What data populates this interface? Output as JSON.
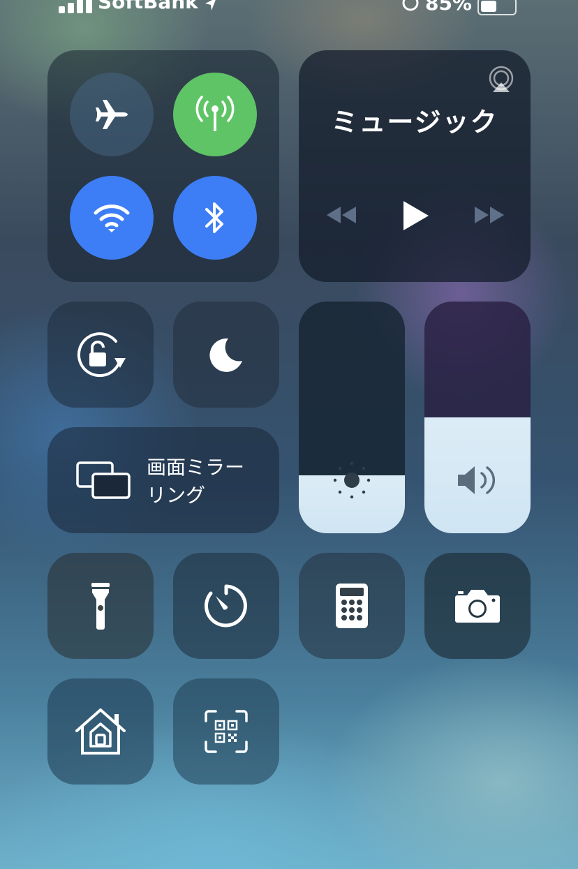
{
  "status_bar": {
    "carrier": "SoftBank",
    "battery_text": "85%",
    "signal_bars": 4
  },
  "connectivity": {
    "airplane": {
      "icon": "airplane-icon",
      "state": "off",
      "color": "#4a6a86"
    },
    "cellular": {
      "icon": "cellular-antenna-icon",
      "state": "on",
      "color": "#5fc465"
    },
    "wifi": {
      "icon": "wifi-icon",
      "state": "on",
      "color": "#3d7ef6"
    },
    "bluetooth": {
      "icon": "bluetooth-icon",
      "state": "on",
      "color": "#3d7ef6"
    }
  },
  "music": {
    "title": "ミュージック",
    "airplay_icon": "airplay-icon",
    "controls": [
      "rewind-icon",
      "play-icon",
      "fast-forward-icon"
    ]
  },
  "tiles": {
    "rotation_lock": {
      "icon": "rotation-lock-icon"
    },
    "do_not_disturb": {
      "icon": "moon-icon"
    },
    "screen_mirroring": {
      "icon": "screen-mirroring-icon",
      "label_line1": "画面ミラー",
      "label_line2": "リング"
    },
    "flashlight": {
      "icon": "flashlight-icon"
    },
    "timer": {
      "icon": "timer-icon"
    },
    "calculator": {
      "icon": "calculator-icon"
    },
    "camera": {
      "icon": "camera-icon"
    },
    "home": {
      "icon": "home-icon"
    },
    "qr_scanner": {
      "icon": "qr-code-icon"
    }
  },
  "sliders": {
    "brightness": {
      "icon": "sun-icon",
      "level": 0.25
    },
    "volume": {
      "icon": "speaker-icon",
      "level": 0.5
    }
  }
}
